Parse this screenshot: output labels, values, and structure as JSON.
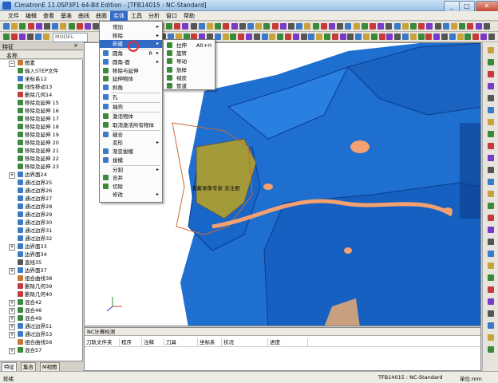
{
  "window": {
    "title": "CimatronE 11.0SP3P1 64-Bit Edition - [TFB14015 : NC-Standard]",
    "min": "_",
    "max": "□",
    "close": "✕"
  },
  "menubar": [
    "文件",
    "编辑",
    "查看",
    "基准",
    "曲线",
    "曲面",
    "实体",
    "工具",
    "分析",
    "窗口",
    "帮助"
  ],
  "toolbar": {
    "model_combo": "MODEL"
  },
  "left_panel": {
    "title": "特征",
    "column_header": "名称",
    "items": [
      {
        "label": "图素",
        "expand": "−",
        "icon_color": "#c87832"
      },
      {
        "label": "输入STEP文件",
        "expand": "",
        "icon_color": "#3a8a3a"
      },
      {
        "label": "坐标系12",
        "expand": "",
        "icon_color": "#3a7ac8"
      },
      {
        "label": "线性移动13",
        "expand": "",
        "icon_color": "#3a8a3a"
      },
      {
        "label": "删除几何14",
        "expand": "",
        "icon_color": "#c83a3a"
      },
      {
        "label": "移除及延伸 15",
        "expand": "",
        "icon_color": "#3a8a3a"
      },
      {
        "label": "移除及延伸 16",
        "expand": "",
        "icon_color": "#3a8a3a"
      },
      {
        "label": "移除及延伸 17",
        "expand": "",
        "icon_color": "#3a8a3a"
      },
      {
        "label": "移除及延伸 18",
        "expand": "",
        "icon_color": "#3a8a3a"
      },
      {
        "label": "移除及延伸 19",
        "expand": "",
        "icon_color": "#3a8a3a"
      },
      {
        "label": "移除及延伸 20",
        "expand": "",
        "icon_color": "#3a8a3a"
      },
      {
        "label": "移除及延伸 21",
        "expand": "",
        "icon_color": "#3a8a3a"
      },
      {
        "label": "移除及延伸 22",
        "expand": "",
        "icon_color": "#3a8a3a"
      },
      {
        "label": "移除及延伸 23",
        "expand": "",
        "icon_color": "#3a8a3a"
      },
      {
        "label": "边界面24",
        "expand": "+",
        "icon_color": "#3a7ac8"
      },
      {
        "label": "通过边界25",
        "expand": "",
        "icon_color": "#3a7ac8"
      },
      {
        "label": "通过边界26",
        "expand": "",
        "icon_color": "#3a7ac8"
      },
      {
        "label": "通过边界27",
        "expand": "",
        "icon_color": "#3a7ac8"
      },
      {
        "label": "通过边界28",
        "expand": "",
        "icon_color": "#3a7ac8"
      },
      {
        "label": "通过边界29",
        "expand": "",
        "icon_color": "#3a7ac8"
      },
      {
        "label": "通过边界30",
        "expand": "",
        "icon_color": "#3a7ac8"
      },
      {
        "label": "通过边界31",
        "expand": "",
        "icon_color": "#3a7ac8"
      },
      {
        "label": "通过边界32",
        "expand": "",
        "icon_color": "#3a7ac8"
      },
      {
        "label": "边界面33",
        "expand": "+",
        "icon_color": "#3a7ac8"
      },
      {
        "label": "边界面34",
        "expand": "",
        "icon_color": "#3a7ac8"
      },
      {
        "label": "直线35",
        "expand": "",
        "icon_color": "#555555"
      },
      {
        "label": "边界面37",
        "expand": "+",
        "icon_color": "#3a7ac8"
      },
      {
        "label": "组合曲线38",
        "expand": "",
        "icon_color": "#c87832"
      },
      {
        "label": "删除几何39",
        "expand": "",
        "icon_color": "#c83a3a"
      },
      {
        "label": "删除几何40",
        "expand": "",
        "icon_color": "#c83a3a"
      },
      {
        "label": "混合42",
        "expand": "+",
        "icon_color": "#3a8a3a"
      },
      {
        "label": "混合46",
        "expand": "+",
        "icon_color": "#3a8a3a"
      },
      {
        "label": "混合49",
        "expand": "+",
        "icon_color": "#3a8a3a"
      },
      {
        "label": "通过边界51",
        "expand": "+",
        "icon_color": "#3a7ac8"
      },
      {
        "label": "通过边界53",
        "expand": "+",
        "icon_color": "#3a7ac8"
      },
      {
        "label": "组合曲线56",
        "expand": "",
        "icon_color": "#c87832"
      },
      {
        "label": "混合57",
        "expand": "+",
        "icon_color": "#3a8a3a"
      }
    ],
    "tabs": [
      "特征",
      "集合",
      "M视图"
    ]
  },
  "solid_menu": {
    "items": [
      {
        "label": "增加",
        "arrow": "▸",
        "icon_color": ""
      },
      {
        "label": "移除",
        "arrow": "▸",
        "icon_color": ""
      },
      {
        "label": "新建",
        "arrow": "▸",
        "icon_color": "",
        "highlight": true
      },
      {
        "label": "圆角",
        "shortcut": "R",
        "arrow": "▸",
        "icon_color": "#3a7ac8"
      },
      {
        "label": "圆角-面",
        "arrow": "▸",
        "icon_color": "#3a7ac8"
      },
      {
        "label": "移除与延伸",
        "arrow": "",
        "icon_color": "#3a8a3a"
      },
      {
        "label": "延伸物体",
        "arrow": "",
        "icon_color": "#3a8a3a"
      },
      {
        "label": "斜角",
        "arrow": "",
        "icon_color": "#3a7ac8"
      },
      {
        "label": "孔",
        "arrow": "",
        "icon_color": "#3a7ac8"
      },
      {
        "label": "抽壳",
        "arrow": "",
        "icon_color": "#3a7ac8"
      },
      {
        "label": "激活物体",
        "arrow": "",
        "icon_color": "#3a8a3a"
      },
      {
        "label": "取消激活所有物体",
        "arrow": "",
        "icon_color": "#3a8a3a"
      },
      {
        "label": "缝合",
        "arrow": "",
        "icon_color": "#3a7ac8"
      },
      {
        "label": "变形",
        "arrow": "▸",
        "icon_color": ""
      },
      {
        "label": "渐变拔模",
        "arrow": "",
        "icon_color": "#3a7ac8"
      },
      {
        "label": "拔模",
        "arrow": "",
        "icon_color": "#3a7ac8"
      },
      {
        "label": "分割",
        "arrow": "▸",
        "icon_color": ""
      },
      {
        "label": "合并",
        "arrow": "",
        "icon_color": "#3a8a3a"
      },
      {
        "label": "切除",
        "arrow": "",
        "icon_color": "#3a8a3a"
      },
      {
        "label": "修改",
        "arrow": "▸",
        "icon_color": ""
      }
    ]
  },
  "new_submenu": {
    "items": [
      {
        "label": "拉伸",
        "shortcut": "Alt+H",
        "icon_color": "#3a8a3a"
      },
      {
        "label": "旋转",
        "shortcut": "",
        "icon_color": "#3a8a3a"
      },
      {
        "label": "导动",
        "shortcut": "",
        "icon_color": "#3a8a3a"
      },
      {
        "label": "放样",
        "shortcut": "",
        "icon_color": "#3a8a3a"
      },
      {
        "label": "褶皮",
        "shortcut": "",
        "icon_color": "#3a8a3a"
      },
      {
        "label": "管道",
        "shortcut": "",
        "icon_color": "#3a8a3a"
      }
    ]
  },
  "viewport": {
    "annotation": "潮蓄录像专家 未注册"
  },
  "nc_panel": {
    "title": "NC计算检测",
    "columns": [
      "刀轨文件夹",
      "程序",
      "注释",
      "刀具",
      "坐标系",
      "状况",
      "进度"
    ]
  },
  "statusbar": {
    "left": "就绪",
    "doc": "TFB14015 : NC-Standard",
    "unit": "单位:mm"
  },
  "colors": {
    "part_blue": "#1f6fd0",
    "part_dark": "#0a3d8c",
    "highlight": "#316ac5",
    "orange": "#f4a070",
    "olive": "#a39a3a"
  }
}
